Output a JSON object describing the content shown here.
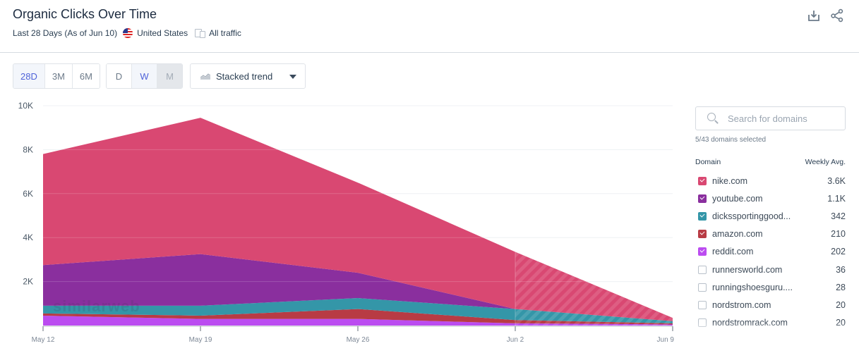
{
  "header": {
    "title": "Organic Clicks Over Time",
    "period": "Last 28 Days (As of Jun 10)",
    "country": "United States",
    "traffic": "All traffic",
    "icons": [
      "download-icon",
      "share-icon"
    ]
  },
  "controls": {
    "range_buttons": [
      {
        "label": "28D",
        "state": "active"
      },
      {
        "label": "3M",
        "state": "normal"
      },
      {
        "label": "6M",
        "state": "normal"
      }
    ],
    "granularity_buttons": [
      {
        "label": "D",
        "state": "normal"
      },
      {
        "label": "W",
        "state": "active"
      },
      {
        "label": "M",
        "state": "disabled"
      }
    ],
    "chart_type": "Stacked trend"
  },
  "panel": {
    "search_placeholder": "Search for domains",
    "selected_count": "5/43 domains selected",
    "col_domain": "Domain",
    "col_value": "Weekly Avg.",
    "domains": [
      {
        "name": "nike.com",
        "value": "3.6K",
        "checked": true,
        "color": "#d94872"
      },
      {
        "name": "youtube.com",
        "value": "1.1K",
        "checked": true,
        "color": "#8a2f9e"
      },
      {
        "name": "dickssportinggood...",
        "value": "342",
        "checked": true,
        "color": "#3496a8"
      },
      {
        "name": "amazon.com",
        "value": "210",
        "checked": true,
        "color": "#b83b44"
      },
      {
        "name": "reddit.com",
        "value": "202",
        "checked": true,
        "color": "#bb4cf0"
      },
      {
        "name": "runnersworld.com",
        "value": "36",
        "checked": false
      },
      {
        "name": "runningshoesguru....",
        "value": "28",
        "checked": false
      },
      {
        "name": "nordstrom.com",
        "value": "20",
        "checked": false
      },
      {
        "name": "nordstromrack.com",
        "value": "20",
        "checked": false
      }
    ]
  },
  "watermark": "similarweb",
  "chart_data": {
    "type": "area",
    "stacked": true,
    "title": "Organic Clicks Over Time",
    "xlabel": "",
    "ylabel": "",
    "categories": [
      "May 12",
      "May 19",
      "May 26",
      "Jun 2",
      "Jun 9"
    ],
    "y_ticks": [
      "2K",
      "4K",
      "6K",
      "8K",
      "10K"
    ],
    "y_tick_values": [
      2000,
      4000,
      6000,
      8000,
      10000
    ],
    "ylim": [
      0,
      10000
    ],
    "grid": true,
    "incomplete_from_index": 3,
    "series": [
      {
        "name": "reddit.com",
        "color": "#bb4cf0",
        "values": [
          450,
          300,
          300,
          100,
          50
        ]
      },
      {
        "name": "amazon.com",
        "color": "#b83b44",
        "values": [
          100,
          150,
          450,
          150,
          50
        ]
      },
      {
        "name": "dickssportinggoods.com",
        "color": "#3496a8",
        "values": [
          350,
          450,
          500,
          500,
          100
        ]
      },
      {
        "name": "youtube.com",
        "color": "#8a2f9e",
        "values": [
          1850,
          2350,
          1150,
          0,
          0
        ]
      },
      {
        "name": "nike.com",
        "color": "#d94872",
        "values": [
          5050,
          6200,
          4100,
          2600,
          150
        ]
      }
    ]
  }
}
